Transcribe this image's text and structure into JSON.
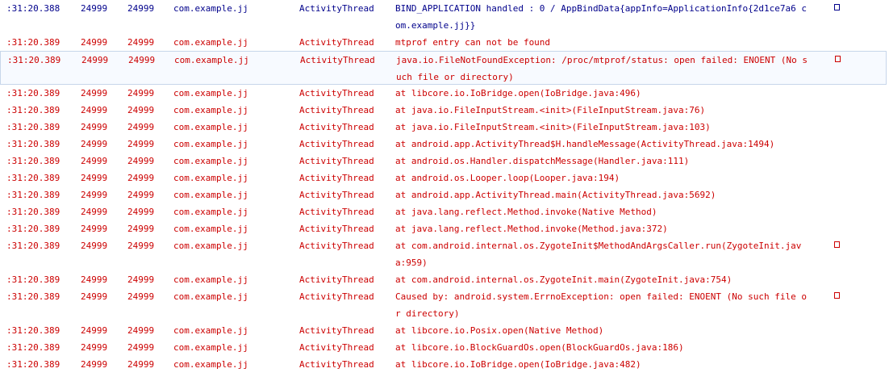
{
  "colors": {
    "info": "#00008b",
    "error": "#cc0000"
  },
  "rows": [
    {
      "time": ":31:20.388",
      "pid": "24999",
      "tid": "24999",
      "app": "com.example.jj",
      "tag": "ActivityThread",
      "level": "info",
      "lines": [
        "BIND_APPLICATION handled : 0 / AppBindData{appInfo=ApplicationInfo{2d1ce7a6 c",
        "om.example.jj}}"
      ],
      "wrap": true
    },
    {
      "time": ":31:20.389",
      "pid": "24999",
      "tid": "24999",
      "app": "com.example.jj",
      "tag": "ActivityThread",
      "level": "error",
      "lines": [
        "mtprof entry can not be found"
      ]
    },
    {
      "time": ":31:20.389",
      "pid": "24999",
      "tid": "24999",
      "app": "com.example.jj",
      "tag": "ActivityThread",
      "level": "error",
      "selected": true,
      "lines": [
        "java.io.FileNotFoundException: /proc/mtprof/status: open failed: ENOENT (No s",
        "uch file or directory)"
      ],
      "wrap": true
    },
    {
      "time": ":31:20.389",
      "pid": "24999",
      "tid": "24999",
      "app": "com.example.jj",
      "tag": "ActivityThread",
      "level": "error",
      "lines": [
        "at libcore.io.IoBridge.open(IoBridge.java:496)"
      ]
    },
    {
      "time": ":31:20.389",
      "pid": "24999",
      "tid": "24999",
      "app": "com.example.jj",
      "tag": "ActivityThread",
      "level": "error",
      "lines": [
        "at java.io.FileInputStream.<init>(FileInputStream.java:76)"
      ]
    },
    {
      "time": ":31:20.389",
      "pid": "24999",
      "tid": "24999",
      "app": "com.example.jj",
      "tag": "ActivityThread",
      "level": "error",
      "lines": [
        "at java.io.FileInputStream.<init>(FileInputStream.java:103)"
      ]
    },
    {
      "time": ":31:20.389",
      "pid": "24999",
      "tid": "24999",
      "app": "com.example.jj",
      "tag": "ActivityThread",
      "level": "error",
      "lines": [
        "at android.app.ActivityThread$H.handleMessage(ActivityThread.java:1494)"
      ]
    },
    {
      "time": ":31:20.389",
      "pid": "24999",
      "tid": "24999",
      "app": "com.example.jj",
      "tag": "ActivityThread",
      "level": "error",
      "lines": [
        "at android.os.Handler.dispatchMessage(Handler.java:111)"
      ]
    },
    {
      "time": ":31:20.389",
      "pid": "24999",
      "tid": "24999",
      "app": "com.example.jj",
      "tag": "ActivityThread",
      "level": "error",
      "lines": [
        "at android.os.Looper.loop(Looper.java:194)"
      ]
    },
    {
      "time": ":31:20.389",
      "pid": "24999",
      "tid": "24999",
      "app": "com.example.jj",
      "tag": "ActivityThread",
      "level": "error",
      "lines": [
        "at android.app.ActivityThread.main(ActivityThread.java:5692)"
      ]
    },
    {
      "time": ":31:20.389",
      "pid": "24999",
      "tid": "24999",
      "app": "com.example.jj",
      "tag": "ActivityThread",
      "level": "error",
      "lines": [
        "at java.lang.reflect.Method.invoke(Native Method)"
      ]
    },
    {
      "time": ":31:20.389",
      "pid": "24999",
      "tid": "24999",
      "app": "com.example.jj",
      "tag": "ActivityThread",
      "level": "error",
      "lines": [
        "at java.lang.reflect.Method.invoke(Method.java:372)"
      ]
    },
    {
      "time": ":31:20.389",
      "pid": "24999",
      "tid": "24999",
      "app": "com.example.jj",
      "tag": "ActivityThread",
      "level": "error",
      "lines": [
        "at com.android.internal.os.ZygoteInit$MethodAndArgsCaller.run(ZygoteInit.jav",
        "a:959)"
      ],
      "wrap": true
    },
    {
      "time": ":31:20.389",
      "pid": "24999",
      "tid": "24999",
      "app": "com.example.jj",
      "tag": "ActivityThread",
      "level": "error",
      "lines": [
        "at com.android.internal.os.ZygoteInit.main(ZygoteInit.java:754)"
      ]
    },
    {
      "time": ":31:20.389",
      "pid": "24999",
      "tid": "24999",
      "app": "com.example.jj",
      "tag": "ActivityThread",
      "level": "error",
      "lines": [
        "Caused by: android.system.ErrnoException: open failed: ENOENT (No such file o",
        "r directory)"
      ],
      "wrap": true
    },
    {
      "time": ":31:20.389",
      "pid": "24999",
      "tid": "24999",
      "app": "com.example.jj",
      "tag": "ActivityThread",
      "level": "error",
      "lines": [
        "at libcore.io.Posix.open(Native Method)"
      ]
    },
    {
      "time": ":31:20.389",
      "pid": "24999",
      "tid": "24999",
      "app": "com.example.jj",
      "tag": "ActivityThread",
      "level": "error",
      "lines": [
        "at libcore.io.BlockGuardOs.open(BlockGuardOs.java:186)"
      ]
    },
    {
      "time": ":31:20.389",
      "pid": "24999",
      "tid": "24999",
      "app": "com.example.jj",
      "tag": "ActivityThread",
      "level": "error",
      "lines": [
        "at libcore.io.IoBridge.open(IoBridge.java:482)"
      ]
    }
  ]
}
